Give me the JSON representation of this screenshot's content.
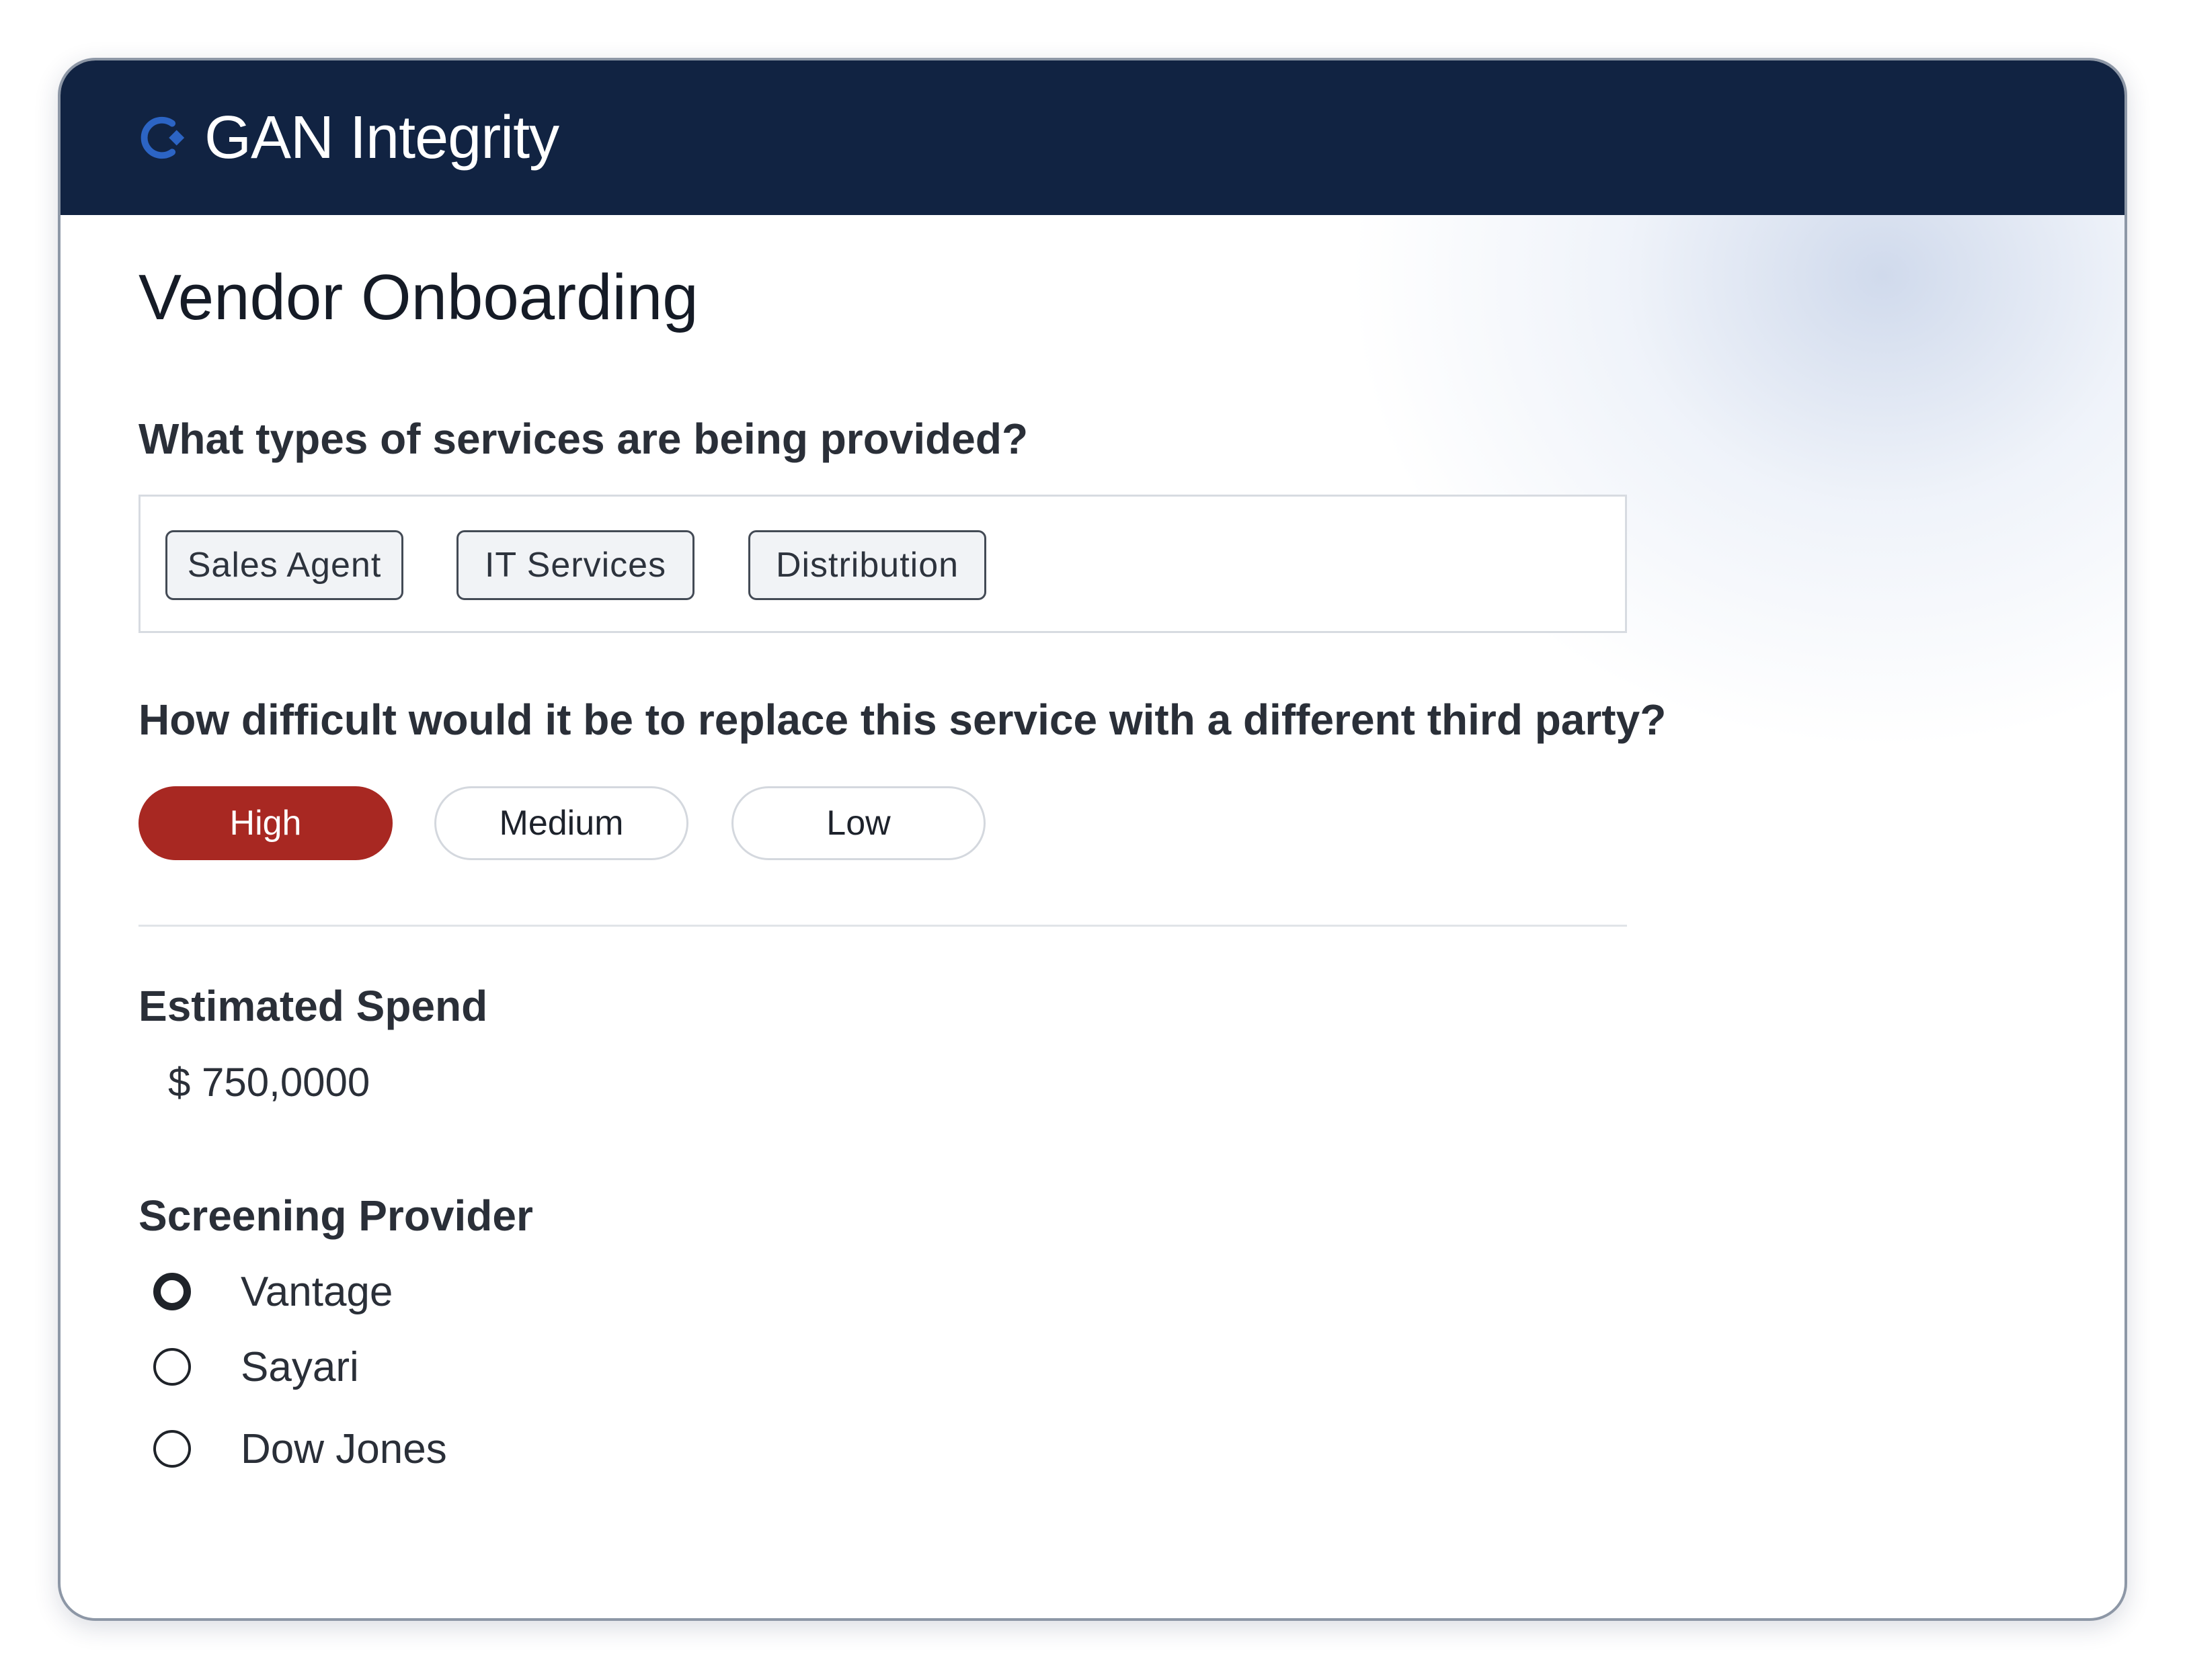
{
  "brand": {
    "name": "GAN Integrity",
    "mark_color": "#2c64c4",
    "header_color": "#112342",
    "logo_icon": "gan-logo-icon"
  },
  "page": {
    "title": "Vendor Onboarding"
  },
  "services": {
    "question": "What types of services are being provided?",
    "tags": [
      "Sales Agent",
      "IT Services",
      "Distribution"
    ]
  },
  "difficulty": {
    "question": "How difficult would it be to replace this service with a different third party?",
    "options": [
      "High",
      "Medium",
      "Low"
    ],
    "selected": "High",
    "selected_color": "#a82822"
  },
  "spend": {
    "label": "Estimated Spend",
    "value": "$ 750,0000"
  },
  "screening": {
    "label": "Screening Provider",
    "options": [
      "Vantage",
      "Sayari",
      "Dow Jones"
    ],
    "selected": "Vantage"
  }
}
